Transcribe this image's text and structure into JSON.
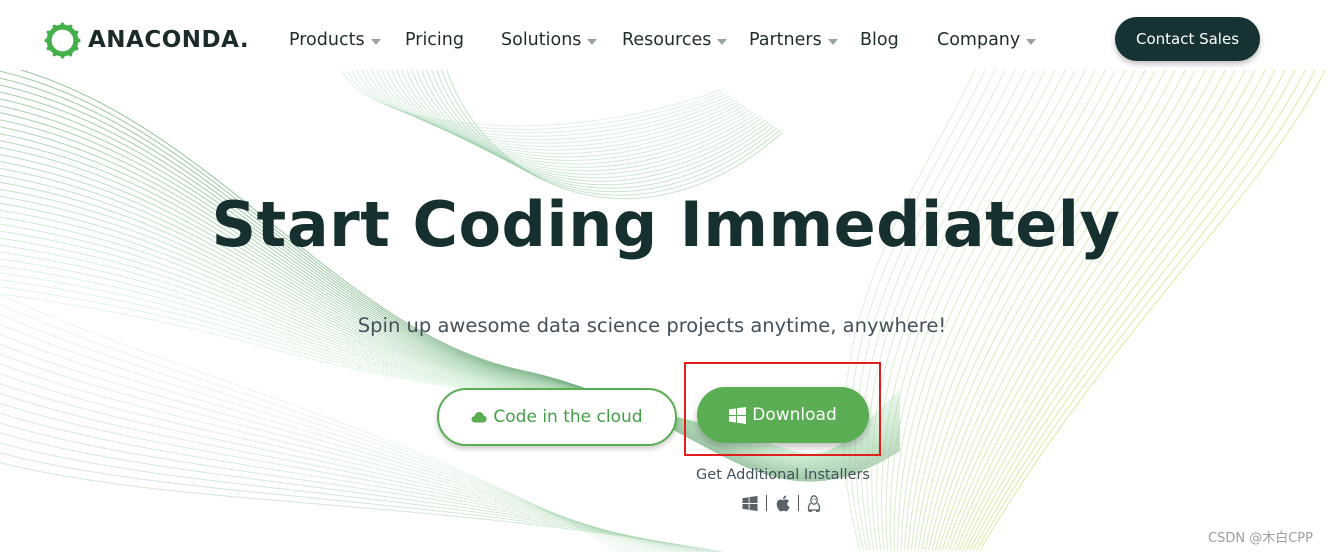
{
  "brand": {
    "name": "ANACONDA.",
    "accent": "#43b049",
    "dark": "#173234"
  },
  "nav": {
    "items": [
      {
        "label": "Products",
        "has_menu": true
      },
      {
        "label": "Pricing",
        "has_menu": false
      },
      {
        "label": "Solutions",
        "has_menu": true
      },
      {
        "label": "Resources",
        "has_menu": true
      },
      {
        "label": "Partners",
        "has_menu": true
      },
      {
        "label": "Blog",
        "has_menu": false
      },
      {
        "label": "Company",
        "has_menu": true
      }
    ],
    "contact_label": "Contact Sales"
  },
  "hero": {
    "title": "Start Coding Immediately",
    "subtitle": "Spin up awesome data science projects anytime, anywhere!",
    "cloud_button": {
      "label": "Code in the cloud",
      "icon": "cloud-icon"
    },
    "download_button": {
      "label": "Download",
      "icon": "windows-icon",
      "highlight_color": "#e01e1e"
    },
    "additional_label": "Get Additional Installers",
    "os_icons": [
      "windows-icon",
      "apple-icon",
      "linux-icon"
    ]
  },
  "watermark": "CSDN @木白CPP"
}
